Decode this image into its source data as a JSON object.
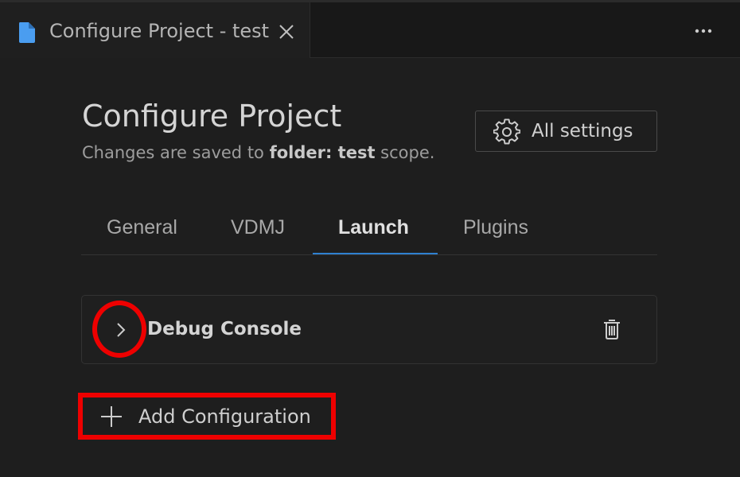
{
  "editor_tab": {
    "title": "Configure Project - test",
    "icon": "file-icon",
    "close_icon": "close-icon"
  },
  "toolbar": {
    "more_icon": "more-actions-icon"
  },
  "header": {
    "title": "Configure Project",
    "subtitle_prefix": "Changes are saved to ",
    "subtitle_scope": "folder: test",
    "subtitle_suffix": " scope.",
    "all_settings_label": "All settings",
    "all_settings_icon": "gear-icon"
  },
  "tabs": [
    {
      "label": "General",
      "active": false
    },
    {
      "label": "VDMJ",
      "active": false
    },
    {
      "label": "Launch",
      "active": true
    },
    {
      "label": "Plugins",
      "active": false
    }
  ],
  "configurations": [
    {
      "name": "Debug Console",
      "expanded": false
    }
  ],
  "add_configuration": {
    "label": "Add Configuration",
    "icon": "plus-icon"
  },
  "colors": {
    "background": "#1e1e1e",
    "accent": "#2f80d0",
    "highlight": "#ee0000",
    "file_icon": "#4a9df0"
  }
}
